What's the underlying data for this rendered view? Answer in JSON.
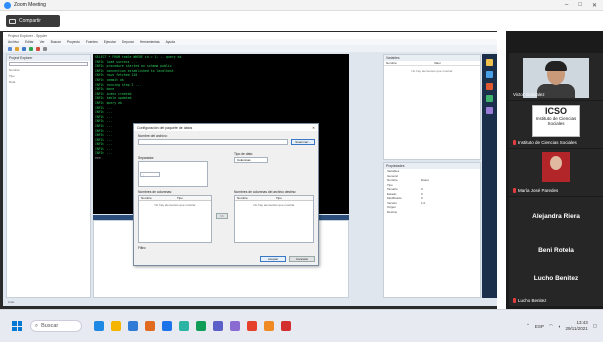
{
  "window": {
    "title": "Zoom Meeting",
    "controls": [
      "–",
      "□",
      "✕"
    ]
  },
  "share_banner": {
    "label": "Compartir"
  },
  "ide": {
    "title": "Project Explorer - Spyder",
    "menu": [
      "Archivo",
      "Editar",
      "Ver",
      "Buscar",
      "Proyecto",
      "Fuentes",
      "Ejecutar",
      "Depurar",
      "Herramientas",
      "Ayuda"
    ],
    "left_panel": {
      "title": "Project Explorer",
      "lines": [
        "Nombre",
        "Tipo",
        "Ruta"
      ]
    },
    "console_lines": [
      {
        "c": "g",
        "t": "SELECT * FROM table WHERE id = 1; -- query ok"
      },
      {
        "c": "g",
        "t": "INFO: load success ..."
      },
      {
        "c": "g",
        "t": "INFO: procedure started on schema public"
      },
      {
        "c": "g",
        "t": "INFO: connection established to localhost"
      },
      {
        "c": "g",
        "t": "INFO: rows fetched 120"
      },
      {
        "c": "g",
        "t": "INFO: commit ok"
      },
      {
        "c": "g",
        "t": "INFO: running step 2 ..."
      },
      {
        "c": "g",
        "t": "INFO: done"
      },
      {
        "c": "g",
        "t": "INFO: index created"
      },
      {
        "c": "g",
        "t": "INFO: table updated"
      },
      {
        "c": "g",
        "t": "INFO: query ok"
      },
      {
        "c": "g",
        "t": "INFO: ..."
      },
      {
        "c": "g",
        "t": "INFO: ..."
      },
      {
        "c": "g",
        "t": "INFO: ..."
      },
      {
        "c": "g",
        "t": "INFO: ..."
      },
      {
        "c": "g",
        "t": "INFO: ..."
      },
      {
        "c": "g",
        "t": "INFO: ..."
      },
      {
        "c": "g",
        "t": "INFO: ..."
      },
      {
        "c": "g",
        "t": "INFO: ..."
      },
      {
        "c": "g",
        "t": "INFO: ..."
      },
      {
        "c": "g",
        "t": "INFO: ..."
      },
      {
        "c": "g",
        "t": "INFO: ..."
      },
      {
        "c": "w",
        "t": ">>>"
      }
    ],
    "right_panel": {
      "title": "Variables",
      "cols": [
        "Nombre",
        "Valor"
      ],
      "empty": "No hay elementos que mostrar"
    },
    "props_panel": {
      "title": "Propiedades",
      "rows": [
        {
          "k": "Variables",
          "v": ""
        },
        {
          "k": "General",
          "v": ""
        },
        {
          "k": "Nombre",
          "v": "Datos"
        },
        {
          "k": "Tipo",
          "v": ""
        },
        {
          "k": "Tamaño",
          "v": "0"
        },
        {
          "k": "Estado",
          "v": "0"
        },
        {
          "k": "Modificado",
          "v": "0"
        },
        {
          "k": "Versión",
          "v": "1.0"
        },
        {
          "k": "Origen",
          "v": ""
        },
        {
          "k": "Destino",
          "v": ""
        }
      ]
    },
    "status": "Listo"
  },
  "dialog": {
    "title": "Configuración del paquete de datos",
    "close": "✕",
    "name_label": "Nombre del archivo:",
    "browse_btn": "Examinar...",
    "type_label": "Tipo de dato:",
    "type_value": "Columnas",
    "sep_label": "Separador:",
    "sep_value": ";",
    "left_table": {
      "title": "Nombres de columnas:",
      "cols": [
        "Nombre",
        "Tipo"
      ],
      "empty": "No hay elementos que mostrar"
    },
    "right_table": {
      "title": "Nombres de columnas del archivo destino:",
      "cols": [
        "Nombre",
        "Tipo"
      ],
      "empty": "No hay elementos que mostrar"
    },
    "arrow_btn": ">>",
    "filter_label": "Filtro:",
    "accept": "Aceptar",
    "cancel": "Cancelar"
  },
  "participants": [
    {
      "name": "Victor Gonzalez",
      "type": "video"
    },
    {
      "name": "Instituto de Ciencias Sociales",
      "type": "logo",
      "logo_big": "ICSO",
      "logo_small": "Instituto de Ciencias Sociales"
    },
    {
      "name": "María José Paredes",
      "type": "avatar"
    },
    {
      "name": "Alejandra Riera",
      "type": "text",
      "bigname": "Alejandra Riera"
    },
    {
      "name": "Beni Rotela",
      "type": "text",
      "bigname": "Beni Rotela"
    },
    {
      "name": "Lucho Benitez",
      "type": "text",
      "bigname": "Lucho Benitez"
    }
  ],
  "taskbar": {
    "search_placeholder": "Buscar",
    "time": "13:43",
    "date": "29/11/2021",
    "lang": "ESP",
    "icon_colors": [
      "#1e88e5",
      "#f4b400",
      "#2f7bd6",
      "#e06b1f",
      "#1a73e8",
      "#2bb3a3",
      "#0f9d58",
      "#5b5fc7",
      "#8a6bd1",
      "#e5402c",
      "#f08a24",
      "#d32f2f"
    ]
  },
  "colors": {
    "accent": "#2d8cff",
    "console_green": "#2bd15d",
    "ide_bg": "#dfe6ee"
  }
}
